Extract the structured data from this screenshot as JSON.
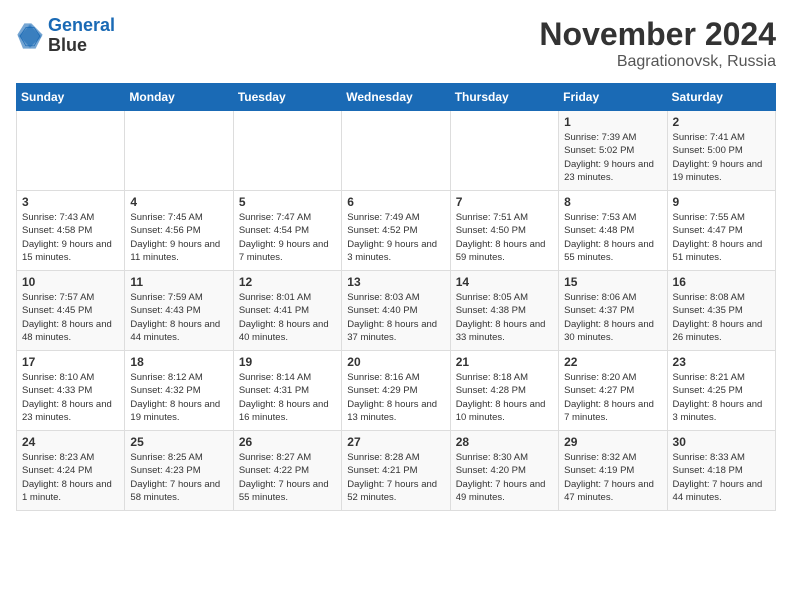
{
  "header": {
    "logo_line1": "General",
    "logo_line2": "Blue",
    "month_year": "November 2024",
    "location": "Bagrationovsk, Russia"
  },
  "weekdays": [
    "Sunday",
    "Monday",
    "Tuesday",
    "Wednesday",
    "Thursday",
    "Friday",
    "Saturday"
  ],
  "weeks": [
    [
      {
        "day": "",
        "sunrise": "",
        "sunset": "",
        "daylight": ""
      },
      {
        "day": "",
        "sunrise": "",
        "sunset": "",
        "daylight": ""
      },
      {
        "day": "",
        "sunrise": "",
        "sunset": "",
        "daylight": ""
      },
      {
        "day": "",
        "sunrise": "",
        "sunset": "",
        "daylight": ""
      },
      {
        "day": "",
        "sunrise": "",
        "sunset": "",
        "daylight": ""
      },
      {
        "day": "1",
        "sunrise": "Sunrise: 7:39 AM",
        "sunset": "Sunset: 5:02 PM",
        "daylight": "Daylight: 9 hours and 23 minutes."
      },
      {
        "day": "2",
        "sunrise": "Sunrise: 7:41 AM",
        "sunset": "Sunset: 5:00 PM",
        "daylight": "Daylight: 9 hours and 19 minutes."
      }
    ],
    [
      {
        "day": "3",
        "sunrise": "Sunrise: 7:43 AM",
        "sunset": "Sunset: 4:58 PM",
        "daylight": "Daylight: 9 hours and 15 minutes."
      },
      {
        "day": "4",
        "sunrise": "Sunrise: 7:45 AM",
        "sunset": "Sunset: 4:56 PM",
        "daylight": "Daylight: 9 hours and 11 minutes."
      },
      {
        "day": "5",
        "sunrise": "Sunrise: 7:47 AM",
        "sunset": "Sunset: 4:54 PM",
        "daylight": "Daylight: 9 hours and 7 minutes."
      },
      {
        "day": "6",
        "sunrise": "Sunrise: 7:49 AM",
        "sunset": "Sunset: 4:52 PM",
        "daylight": "Daylight: 9 hours and 3 minutes."
      },
      {
        "day": "7",
        "sunrise": "Sunrise: 7:51 AM",
        "sunset": "Sunset: 4:50 PM",
        "daylight": "Daylight: 8 hours and 59 minutes."
      },
      {
        "day": "8",
        "sunrise": "Sunrise: 7:53 AM",
        "sunset": "Sunset: 4:48 PM",
        "daylight": "Daylight: 8 hours and 55 minutes."
      },
      {
        "day": "9",
        "sunrise": "Sunrise: 7:55 AM",
        "sunset": "Sunset: 4:47 PM",
        "daylight": "Daylight: 8 hours and 51 minutes."
      }
    ],
    [
      {
        "day": "10",
        "sunrise": "Sunrise: 7:57 AM",
        "sunset": "Sunset: 4:45 PM",
        "daylight": "Daylight: 8 hours and 48 minutes."
      },
      {
        "day": "11",
        "sunrise": "Sunrise: 7:59 AM",
        "sunset": "Sunset: 4:43 PM",
        "daylight": "Daylight: 8 hours and 44 minutes."
      },
      {
        "day": "12",
        "sunrise": "Sunrise: 8:01 AM",
        "sunset": "Sunset: 4:41 PM",
        "daylight": "Daylight: 8 hours and 40 minutes."
      },
      {
        "day": "13",
        "sunrise": "Sunrise: 8:03 AM",
        "sunset": "Sunset: 4:40 PM",
        "daylight": "Daylight: 8 hours and 37 minutes."
      },
      {
        "day": "14",
        "sunrise": "Sunrise: 8:05 AM",
        "sunset": "Sunset: 4:38 PM",
        "daylight": "Daylight: 8 hours and 33 minutes."
      },
      {
        "day": "15",
        "sunrise": "Sunrise: 8:06 AM",
        "sunset": "Sunset: 4:37 PM",
        "daylight": "Daylight: 8 hours and 30 minutes."
      },
      {
        "day": "16",
        "sunrise": "Sunrise: 8:08 AM",
        "sunset": "Sunset: 4:35 PM",
        "daylight": "Daylight: 8 hours and 26 minutes."
      }
    ],
    [
      {
        "day": "17",
        "sunrise": "Sunrise: 8:10 AM",
        "sunset": "Sunset: 4:33 PM",
        "daylight": "Daylight: 8 hours and 23 minutes."
      },
      {
        "day": "18",
        "sunrise": "Sunrise: 8:12 AM",
        "sunset": "Sunset: 4:32 PM",
        "daylight": "Daylight: 8 hours and 19 minutes."
      },
      {
        "day": "19",
        "sunrise": "Sunrise: 8:14 AM",
        "sunset": "Sunset: 4:31 PM",
        "daylight": "Daylight: 8 hours and 16 minutes."
      },
      {
        "day": "20",
        "sunrise": "Sunrise: 8:16 AM",
        "sunset": "Sunset: 4:29 PM",
        "daylight": "Daylight: 8 hours and 13 minutes."
      },
      {
        "day": "21",
        "sunrise": "Sunrise: 8:18 AM",
        "sunset": "Sunset: 4:28 PM",
        "daylight": "Daylight: 8 hours and 10 minutes."
      },
      {
        "day": "22",
        "sunrise": "Sunrise: 8:20 AM",
        "sunset": "Sunset: 4:27 PM",
        "daylight": "Daylight: 8 hours and 7 minutes."
      },
      {
        "day": "23",
        "sunrise": "Sunrise: 8:21 AM",
        "sunset": "Sunset: 4:25 PM",
        "daylight": "Daylight: 8 hours and 3 minutes."
      }
    ],
    [
      {
        "day": "24",
        "sunrise": "Sunrise: 8:23 AM",
        "sunset": "Sunset: 4:24 PM",
        "daylight": "Daylight: 8 hours and 1 minute."
      },
      {
        "day": "25",
        "sunrise": "Sunrise: 8:25 AM",
        "sunset": "Sunset: 4:23 PM",
        "daylight": "Daylight: 7 hours and 58 minutes."
      },
      {
        "day": "26",
        "sunrise": "Sunrise: 8:27 AM",
        "sunset": "Sunset: 4:22 PM",
        "daylight": "Daylight: 7 hours and 55 minutes."
      },
      {
        "day": "27",
        "sunrise": "Sunrise: 8:28 AM",
        "sunset": "Sunset: 4:21 PM",
        "daylight": "Daylight: 7 hours and 52 minutes."
      },
      {
        "day": "28",
        "sunrise": "Sunrise: 8:30 AM",
        "sunset": "Sunset: 4:20 PM",
        "daylight": "Daylight: 7 hours and 49 minutes."
      },
      {
        "day": "29",
        "sunrise": "Sunrise: 8:32 AM",
        "sunset": "Sunset: 4:19 PM",
        "daylight": "Daylight: 7 hours and 47 minutes."
      },
      {
        "day": "30",
        "sunrise": "Sunrise: 8:33 AM",
        "sunset": "Sunset: 4:18 PM",
        "daylight": "Daylight: 7 hours and 44 minutes."
      }
    ]
  ]
}
